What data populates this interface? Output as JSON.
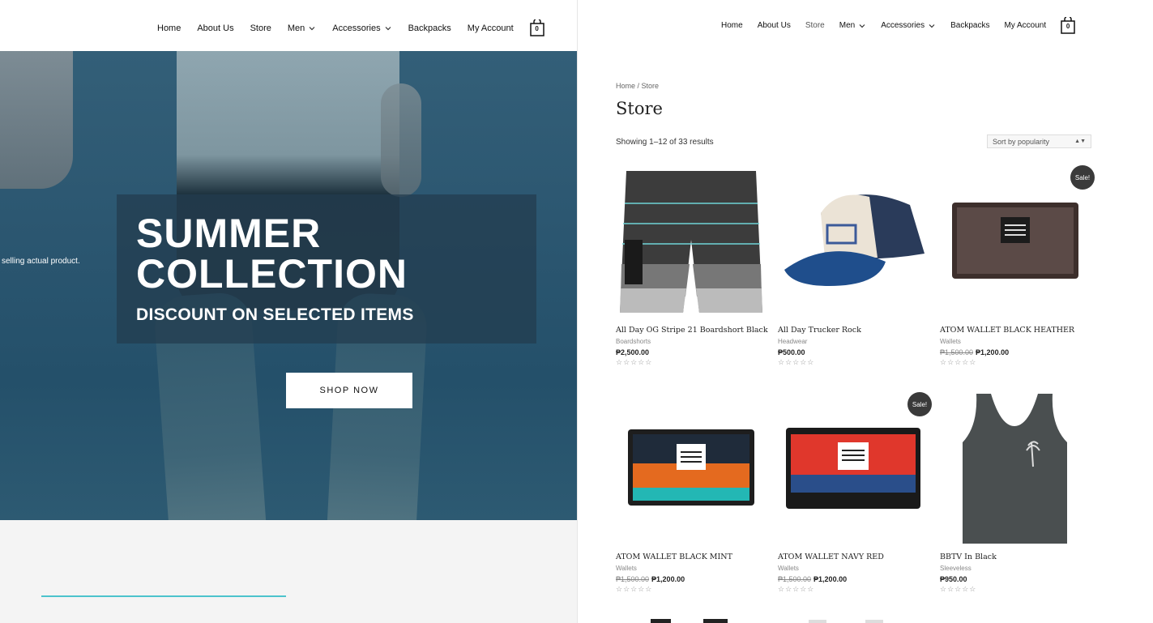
{
  "nav": {
    "items": [
      "Home",
      "About Us",
      "Store",
      "Men",
      "Accessories",
      "Backpacks",
      "My Account"
    ],
    "cart_count": "0"
  },
  "hero": {
    "title_line1": "SUMMER",
    "title_line2": "COLLECTION",
    "subtitle": "DISCOUNT ON SELECTED ITEMS",
    "side_text": "selling actual product.",
    "button": "SHOP NOW"
  },
  "store": {
    "breadcrumb": "Home / Store",
    "title": "Store",
    "results": "Showing 1–12 of 33 results",
    "sort": "Sort by popularity",
    "sale_label": "Sale!",
    "stars": "☆☆☆☆☆",
    "products": [
      {
        "name": "All Day OG Stripe 21 Boardshort Black",
        "category": "Boardshorts",
        "old_price": "",
        "price": "₱2,500.00",
        "sale": false,
        "icon": "boardshort-icon"
      },
      {
        "name": "All Day Trucker Rock",
        "category": "Headwear",
        "old_price": "",
        "price": "₱500.00",
        "sale": false,
        "icon": "trucker-cap-icon"
      },
      {
        "name": "ATOM WALLET BLACK HEATHER",
        "category": "Wallets",
        "old_price": "₱1,500.00",
        "price": "₱1,200.00",
        "sale": true,
        "icon": "wallet-icon"
      },
      {
        "name": "ATOM WALLET BLACK MINT",
        "category": "Wallets",
        "old_price": "₱1,500.00",
        "price": "₱1,200.00",
        "sale": false,
        "icon": "wallet-icon"
      },
      {
        "name": "ATOM WALLET NAVY RED",
        "category": "Wallets",
        "old_price": "₱1,500.00",
        "price": "₱1,200.00",
        "sale": true,
        "icon": "wallet-icon"
      },
      {
        "name": "BBTV In Black",
        "category": "Sleeveless",
        "old_price": "",
        "price": "₱950.00",
        "sale": false,
        "icon": "tank-top-icon"
      }
    ]
  },
  "colors": {
    "accent": "#4cc3cc",
    "sale_badge": "#3a3a3a",
    "hero_overlay": "#233c4e"
  }
}
